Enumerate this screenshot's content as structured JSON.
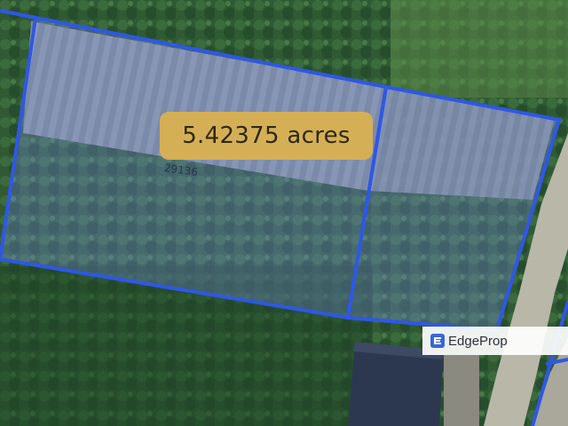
{
  "map": {
    "area_label": "5.42375 acres",
    "lot_number": "29136",
    "boundary_color": "#2f57e6",
    "parcel_fill": "rgba(120,140,230,0.32)",
    "label_bg": "#d9b152"
  },
  "watermark": {
    "text": "EdgeProp",
    "logo_icon": "edgeprop-logo-icon",
    "accent": "#3a67d8"
  }
}
